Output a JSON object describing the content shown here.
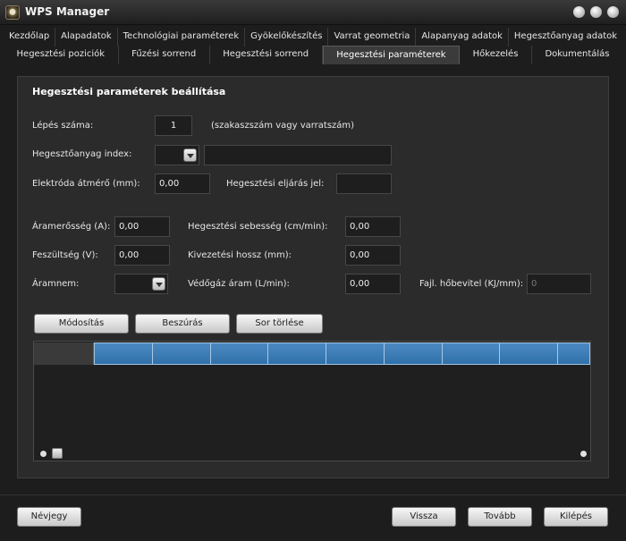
{
  "window": {
    "title": "WPS Manager"
  },
  "tabs_row1": [
    "Kezdőlap",
    "Alapadatok",
    "Technológiai paraméterek",
    "Gyökelőkészítés",
    "Varrat geometria",
    "Alapanyag adatok",
    "Hegesztőanyag adatok"
  ],
  "tabs_row2": [
    "Hegesztési poziciók",
    "Fűzési sorrend",
    "Hegesztési sorrend",
    "Hegesztési paraméterek",
    "Hőkezelés",
    "Dokumentálás"
  ],
  "active_tab": "Hegesztési paraméterek",
  "section_title": "Hegesztési paraméterek beállítása",
  "step": {
    "label": "Lépés száma:",
    "value": "1",
    "hint": "(szakaszszám vagy varratszám)"
  },
  "filler_index": {
    "label": "Hegesztőanyag index:",
    "value": "",
    "text": ""
  },
  "electrode": {
    "label": "Elektróda átmérő (mm):",
    "value": "0,00"
  },
  "process": {
    "label": "Hegesztési eljárás jel:",
    "value": ""
  },
  "current": {
    "label": "Áramerősség (A):",
    "value": "0,00"
  },
  "speed": {
    "label": "Hegesztési sebesség (cm/min):",
    "value": "0,00"
  },
  "voltage": {
    "label": "Feszültség (V):",
    "value": "0,00"
  },
  "stickout": {
    "label": "Kivezetési hossz (mm):",
    "value": "0,00"
  },
  "current_type": {
    "label": "Áramnem:",
    "value": ""
  },
  "shield_gas": {
    "label": "Védőgáz áram (L/min):",
    "value": "0,00"
  },
  "heat_input": {
    "label": "Fajl. hőbevitel (KJ/mm):",
    "value": "0"
  },
  "grid_buttons": {
    "modify": "Módosítás",
    "insert": "Beszúrás",
    "delete": "Sor törlése"
  },
  "footer": {
    "about": "Névjegy",
    "back": "Vissza",
    "next": "Tovább",
    "exit": "Kilépés"
  }
}
